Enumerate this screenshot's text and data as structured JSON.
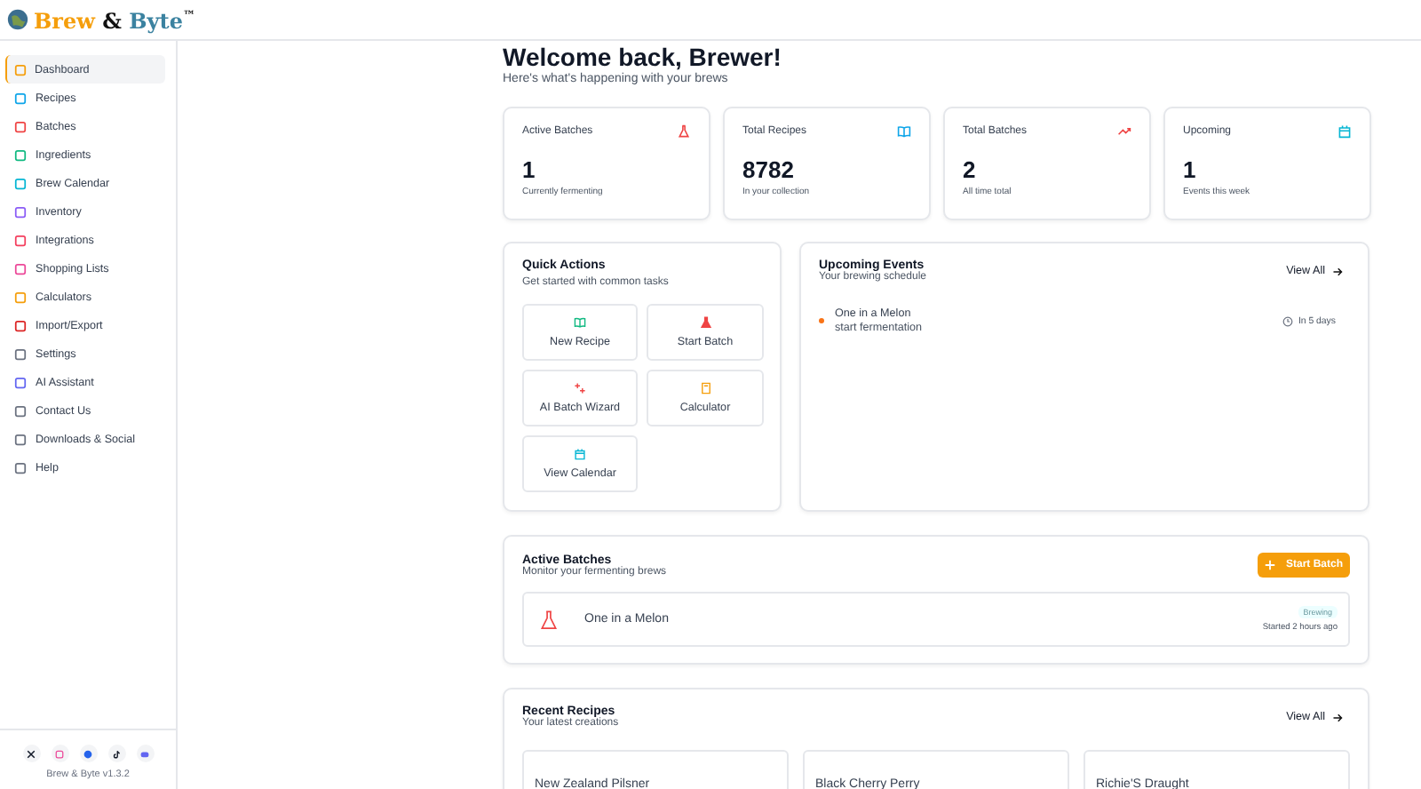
{
  "brand": {
    "name_first": "Brew",
    "amp": "&",
    "name_second": "Byte",
    "tm": "™"
  },
  "sidebar": {
    "items": [
      {
        "label": "Dashboard",
        "selected": true,
        "color": "#f59e0b"
      },
      {
        "label": "Recipes",
        "selected": false,
        "color": "#0ea5e9"
      },
      {
        "label": "Batches",
        "selected": false,
        "color": "#ef4444"
      },
      {
        "label": "Ingredients",
        "selected": false,
        "color": "#10b981"
      },
      {
        "label": "Brew Calendar",
        "selected": false,
        "color": "#06b6d4"
      },
      {
        "label": "Inventory",
        "selected": false,
        "color": "#8b5cf6"
      },
      {
        "label": "Integrations",
        "selected": false,
        "color": "#f43f5e"
      },
      {
        "label": "Shopping Lists",
        "selected": false,
        "color": "#ec4899"
      },
      {
        "label": "Calculators",
        "selected": false,
        "color": "#f59e0b"
      },
      {
        "label": "Import/Export",
        "selected": false,
        "color": "#dc2626"
      },
      {
        "label": "Settings",
        "selected": false,
        "color": "#6b7280"
      },
      {
        "label": "AI Assistant",
        "selected": false,
        "color": "#6366f1"
      },
      {
        "label": "Contact Us",
        "selected": false,
        "color": "#6b7280"
      },
      {
        "label": "Downloads & Social",
        "selected": false,
        "color": "#6b7280"
      },
      {
        "label": "Help",
        "selected": false,
        "color": "#6b7280"
      }
    ],
    "socials": [
      {
        "kind": "x",
        "color": "#111827"
      },
      {
        "kind": "instagram",
        "color": "#ec4899"
      },
      {
        "kind": "facebook",
        "color": "#2563eb"
      },
      {
        "kind": "tiktok",
        "color": "#111827"
      },
      {
        "kind": "discord",
        "color": "#6366f1"
      }
    ],
    "version": "Brew & Byte v1.3.2"
  },
  "welcome": {
    "title": "Welcome back, Brewer!",
    "subtitle": "Here's what's happening with your brews"
  },
  "stats": [
    {
      "label": "Active Batches",
      "value": "1",
      "note": "Currently fermenting",
      "kind": "flask",
      "color": "#ef4444"
    },
    {
      "label": "Total Recipes",
      "value": "8782",
      "note": "In your collection",
      "kind": "book",
      "color": "#0ea5e9"
    },
    {
      "label": "Total Batches",
      "value": "2",
      "note": "All time total",
      "kind": "trend",
      "color": "#ef4444"
    },
    {
      "label": "Upcoming",
      "value": "1",
      "note": "Events this week",
      "kind": "calendar",
      "color": "#06b6d4"
    }
  ],
  "quick_actions": {
    "title": "Quick Actions",
    "subtitle": "Get started with common tasks",
    "actions": [
      {
        "label": "New Recipe",
        "kind": "book",
        "color": "#10b981"
      },
      {
        "label": "Start Batch",
        "kind": "flask",
        "color": "#ef4444"
      },
      {
        "label": "AI Batch Wizard",
        "kind": "sparkle",
        "color": "#ef4444"
      },
      {
        "label": "Calculator",
        "kind": "calculator",
        "color": "#f59e0b"
      },
      {
        "label": "View Calendar",
        "kind": "calendar",
        "color": "#06b6d4"
      }
    ]
  },
  "upcoming_events": {
    "title": "Upcoming Events",
    "subtitle": "Your brewing schedule",
    "view_all": "View All",
    "events": [
      {
        "name": "One in a Melon",
        "action": "start fermentation",
        "when": "In 5 days"
      }
    ]
  },
  "active_batches": {
    "title": "Active Batches",
    "subtitle": "Monitor your fermenting brews",
    "button": "Start Batch",
    "batches": [
      {
        "name": "One in a Melon",
        "status": "Brewing",
        "started": "Started 2 hours ago"
      }
    ]
  },
  "recent_recipes": {
    "title": "Recent Recipes",
    "subtitle": "Your latest creations",
    "view_all": "View All",
    "recipes": [
      {
        "name": "New Zealand Pilsner"
      },
      {
        "name": "Black Cherry Perry"
      },
      {
        "name": "Richie'S Draught"
      }
    ]
  }
}
